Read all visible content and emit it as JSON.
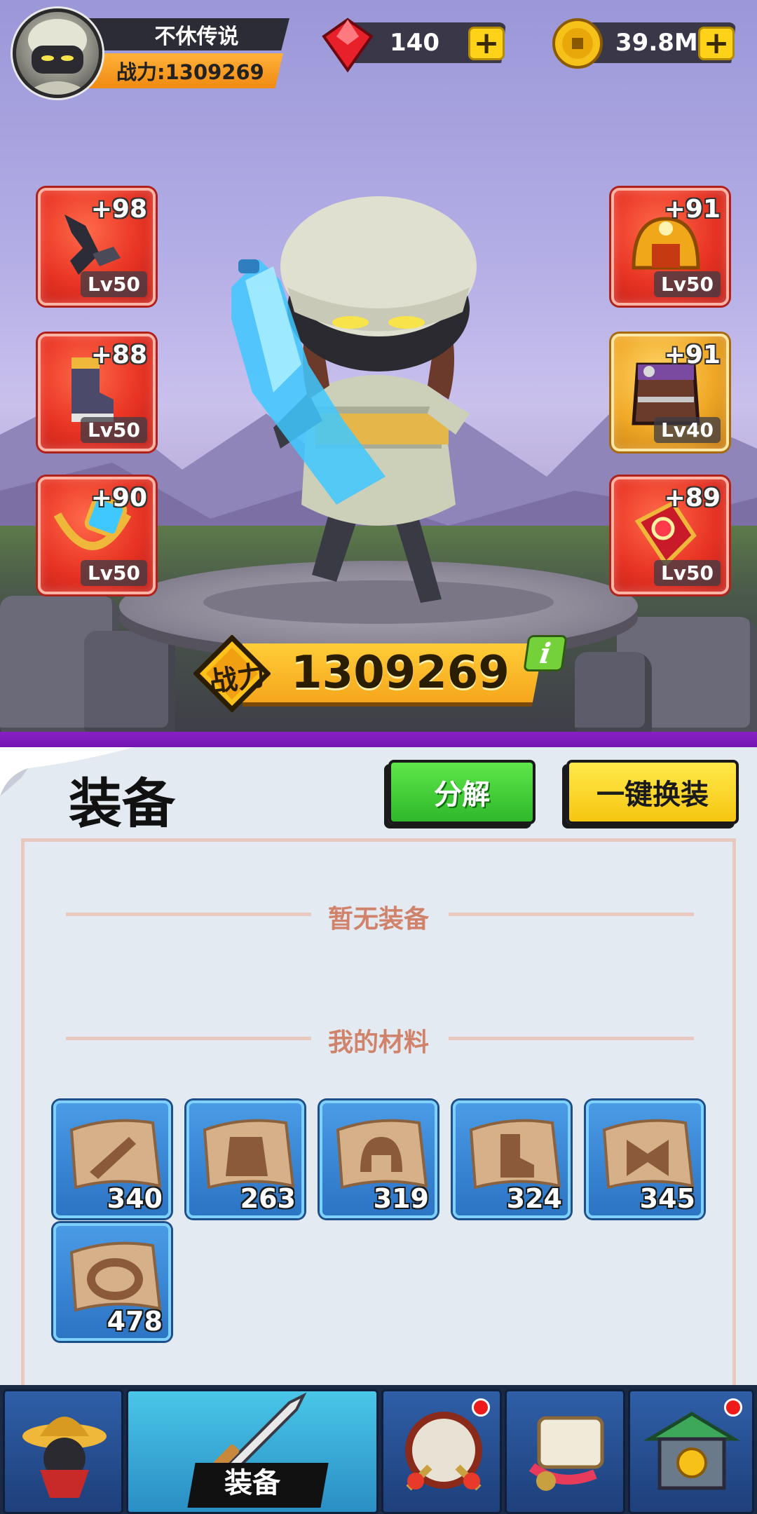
{
  "player": {
    "name": "不休传说",
    "power_label": "战力:1309269"
  },
  "resources": {
    "gems": "140",
    "coins": "39.8M",
    "plus_glyph": "+"
  },
  "equipment_left": [
    {
      "bonus": "+98",
      "level": "Lv50",
      "icon": "sword-icon",
      "rarity": "red"
    },
    {
      "bonus": "+88",
      "level": "Lv50",
      "icon": "boots-icon",
      "rarity": "red"
    },
    {
      "bonus": "+90",
      "level": "Lv50",
      "icon": "necklace-icon",
      "rarity": "red"
    }
  ],
  "equipment_right": [
    {
      "bonus": "+91",
      "level": "Lv50",
      "icon": "helmet-icon",
      "rarity": "red"
    },
    {
      "bonus": "+91",
      "level": "Lv40",
      "icon": "armor-icon",
      "rarity": "gold"
    },
    {
      "bonus": "+89",
      "level": "Lv50",
      "icon": "ring-icon",
      "rarity": "red"
    }
  ],
  "combat_power": {
    "label": "战力",
    "value": "1309269",
    "info_glyph": "i"
  },
  "panel": {
    "title": "装备",
    "decompose_button": "分解",
    "auto_equip_button": "一键换装",
    "no_equipment": "暂无装备",
    "materials_label": "我的材料"
  },
  "materials": [
    {
      "icon": "sword-scroll-icon",
      "count": "340"
    },
    {
      "icon": "armor-scroll-icon",
      "count": "263"
    },
    {
      "icon": "helmet-scroll-icon",
      "count": "319"
    },
    {
      "icon": "boots-scroll-icon",
      "count": "324"
    },
    {
      "icon": "necklace-scroll-icon",
      "count": "345"
    },
    {
      "icon": "ring-scroll-icon",
      "count": "478"
    }
  ],
  "nav": {
    "tabs": [
      {
        "icon": "hero-icon",
        "label": "",
        "badge": false
      },
      {
        "icon": "equipment-icon",
        "label": "装备",
        "badge": false,
        "active": true
      },
      {
        "icon": "drum-icon",
        "label": "",
        "badge": true
      },
      {
        "icon": "scroll-icon",
        "label": "",
        "badge": false
      },
      {
        "icon": "shop-icon",
        "label": "",
        "badge": true
      }
    ]
  },
  "colors": {
    "accent_orange": "#f6a61c",
    "rarity_red": "#e83424",
    "rarity_gold": "#f0a826",
    "material_blue": "#2c74c4",
    "decompose_green": "#2fb82a",
    "auto_equip_yellow": "#f6c611",
    "label_salmon": "#d0826a"
  }
}
